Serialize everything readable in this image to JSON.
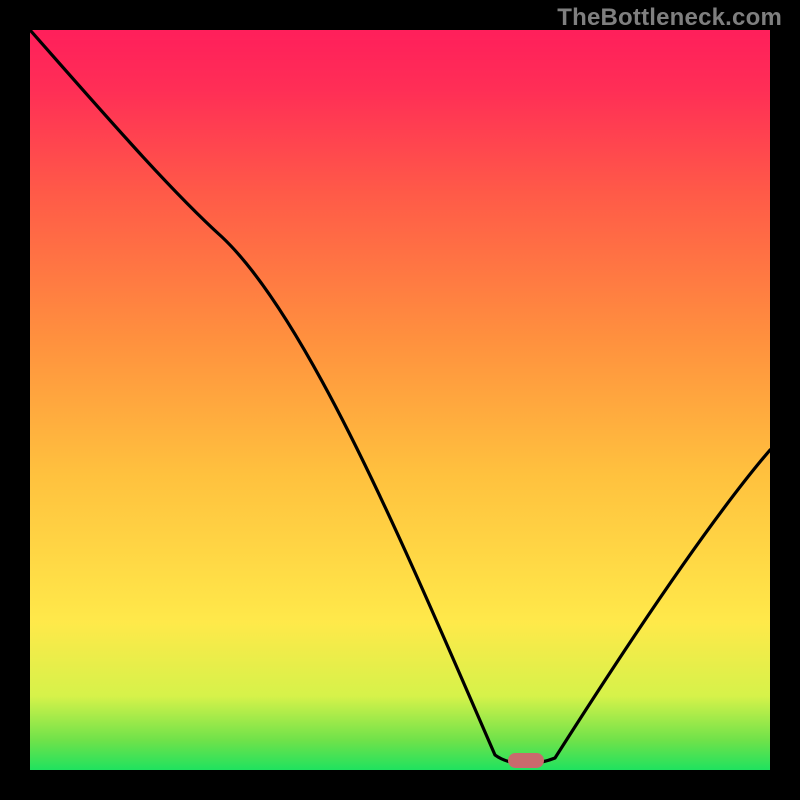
{
  "watermark": "TheBottleneck.com",
  "chart_data": {
    "type": "line",
    "title": "",
    "xlabel": "",
    "ylabel": "",
    "xlim": [
      0,
      100
    ],
    "ylim": [
      0,
      100
    ],
    "x": [
      0,
      26,
      64,
      70,
      100
    ],
    "y": [
      100,
      72,
      1,
      1,
      43
    ],
    "marker": {
      "x": 67,
      "y": 1
    }
  }
}
